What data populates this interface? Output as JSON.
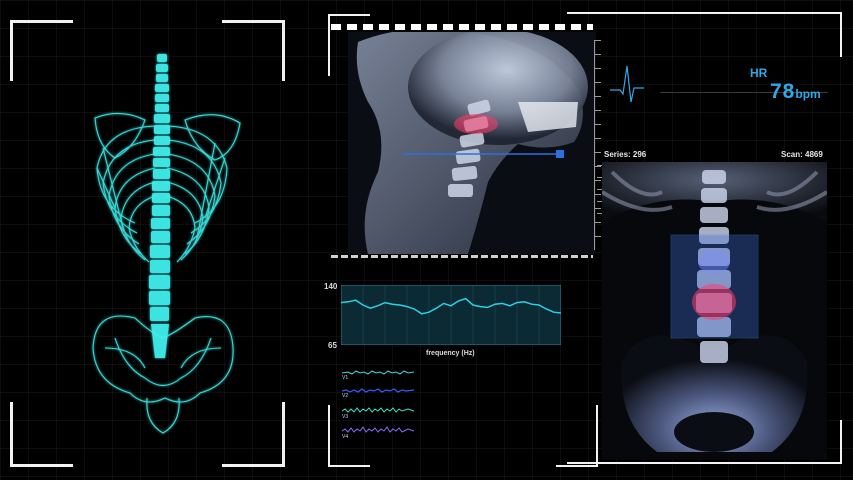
{
  "vitals": {
    "hr_label": "HR",
    "hr_value": "78",
    "hr_unit": "bpm"
  },
  "scan_meta": {
    "series": "Series: 296",
    "scan": "Scan: 4869"
  },
  "chart": {
    "ymax_label": "140",
    "ymin_label": "65",
    "xlabel": "frequency (Hz)"
  },
  "waves": {
    "v1": "V1",
    "v2": "V2",
    "v3": "V3",
    "v4": "V4"
  },
  "chart_data": {
    "type": "line",
    "xlabel": "frequency (Hz)",
    "ylabel": "",
    "ylim": [
      65,
      140
    ],
    "grid": true,
    "x": [
      0,
      1,
      2,
      3,
      4,
      5,
      6,
      7,
      8,
      9,
      10,
      11,
      12,
      13,
      14,
      15,
      16,
      17,
      18,
      19,
      20,
      21,
      22,
      23,
      24,
      25,
      26,
      27,
      28,
      29,
      30
    ],
    "series": [
      {
        "values": [
          118,
          119,
          121,
          115,
          111,
          114,
          118,
          116,
          115,
          113,
          110,
          104,
          106,
          111,
          117,
          114,
          120,
          123,
          115,
          113,
          112,
          116,
          117,
          114,
          118,
          119,
          116,
          115,
          110,
          106,
          105
        ]
      }
    ]
  },
  "colors": {
    "accent": "#2fa8e8",
    "skeleton": "#3ff0ee",
    "chart_line": "#2ad0e8",
    "highlight": "#ff3a6a"
  }
}
